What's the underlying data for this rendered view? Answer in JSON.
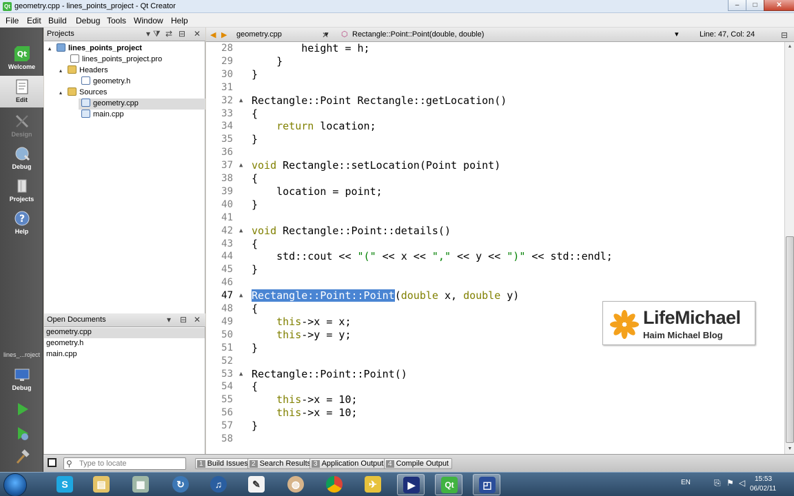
{
  "window": {
    "title": "geometry.cpp - lines_points_project - Qt Creator",
    "controls": {
      "minimize": "–",
      "maximize": "□",
      "close": "✕"
    }
  },
  "menu": [
    "File",
    "Edit",
    "Build",
    "Debug",
    "Tools",
    "Window",
    "Help"
  ],
  "modes": [
    {
      "label": "Welcome",
      "icon": "qt-logo-icon"
    },
    {
      "label": "Edit",
      "icon": "edit-document-icon"
    },
    {
      "label": "Design",
      "icon": "design-brush-icon"
    },
    {
      "label": "Debug",
      "icon": "debug-bug-icon"
    },
    {
      "label": "Projects",
      "icon": "projects-icon"
    },
    {
      "label": "Help",
      "icon": "help-icon"
    }
  ],
  "kit": {
    "project": "lines_...roject",
    "mode": "Debug"
  },
  "projects_panel": {
    "title": "Projects",
    "tree": [
      {
        "label": "lines_points_project",
        "level": 0,
        "icon": "project-icon",
        "bold": true,
        "expand": "▴"
      },
      {
        "label": "lines_points_project.pro",
        "level": 1,
        "icon": "pro-file-icon"
      },
      {
        "label": "Headers",
        "level": 1,
        "icon": "folder-icon",
        "expand": "▴"
      },
      {
        "label": "geometry.h",
        "level": 2,
        "icon": "header-file-icon"
      },
      {
        "label": "Sources",
        "level": 1,
        "icon": "folder-icon",
        "expand": "▴"
      },
      {
        "label": "geometry.cpp",
        "level": 2,
        "icon": "cpp-file-icon",
        "selected": true
      },
      {
        "label": "main.cpp",
        "level": 2,
        "icon": "cpp-file-icon"
      }
    ]
  },
  "open_documents": {
    "title": "Open Documents",
    "items": [
      {
        "label": "geometry.cpp",
        "selected": true
      },
      {
        "label": "geometry.h"
      },
      {
        "label": "main.cpp"
      }
    ]
  },
  "editor_toolbar": {
    "file": "geometry.cpp",
    "symbol": "Rectangle::Point::Point(double, double)",
    "position": "Line: 47, Col: 24"
  },
  "code": [
    {
      "n": "28",
      "t": "        height = h;"
    },
    {
      "n": "29",
      "t": "    }"
    },
    {
      "n": "30",
      "t": "}"
    },
    {
      "n": "31",
      "t": ""
    },
    {
      "n": "32",
      "t": "Rectangle::Point Rectangle::getLocation()",
      "fold": true
    },
    {
      "n": "33",
      "t": "{"
    },
    {
      "n": "34",
      "t": "    return location;",
      "kw": "return"
    },
    {
      "n": "35",
      "t": "}"
    },
    {
      "n": "36",
      "t": ""
    },
    {
      "n": "37",
      "t": "void Rectangle::setLocation(Point point)",
      "fold": true,
      "kw": "void"
    },
    {
      "n": "38",
      "t": "{"
    },
    {
      "n": "39",
      "t": "    location = point;"
    },
    {
      "n": "40",
      "t": "}"
    },
    {
      "n": "41",
      "t": ""
    },
    {
      "n": "42",
      "t": "void Rectangle::Point::details()",
      "fold": true,
      "kw": "void"
    },
    {
      "n": "43",
      "t": "{"
    },
    {
      "n": "44",
      "t": "    std::cout << \"(\" << x << \",\" << y << \")\" << std::endl;"
    },
    {
      "n": "45",
      "t": "}"
    },
    {
      "n": "46",
      "t": ""
    },
    {
      "n": "47",
      "t": "Rectangle::Point::Point(double x, double y)",
      "fold": true,
      "current": true
    },
    {
      "n": "48",
      "t": "{"
    },
    {
      "n": "49",
      "t": "    this->x = x;",
      "kw": "this"
    },
    {
      "n": "50",
      "t": "    this->y = y;",
      "kw": "this"
    },
    {
      "n": "51",
      "t": "}"
    },
    {
      "n": "52",
      "t": ""
    },
    {
      "n": "53",
      "t": "Rectangle::Point::Point()",
      "fold": true
    },
    {
      "n": "54",
      "t": "{"
    },
    {
      "n": "55",
      "t": "    this->x = 10;",
      "kw": "this"
    },
    {
      "n": "56",
      "t": "    this->x = 10;",
      "kw": "this"
    },
    {
      "n": "57",
      "t": "}"
    },
    {
      "n": "58",
      "t": ""
    }
  ],
  "watermark": {
    "brand": "LifeMichael",
    "tagline": "Haim Michael Blog"
  },
  "statusbar": {
    "locator_placeholder": "Type to locate",
    "tabs": [
      {
        "num": "1",
        "label": "Build Issues"
      },
      {
        "num": "2",
        "label": "Search Results"
      },
      {
        "num": "3",
        "label": "Application Output"
      },
      {
        "num": "4",
        "label": "Compile Output"
      }
    ]
  },
  "taskbar": {
    "apps": [
      "ie-icon",
      "skype-icon",
      "explorer-icon",
      "calculator-icon",
      "sync-icon",
      "itunes-icon",
      "notepad-icon",
      "paint-icon",
      "chrome-icon",
      "game-icon",
      "media-player-icon",
      "qt-creator-icon",
      "app-icon"
    ],
    "lang": "EN",
    "time": "15:53",
    "date": "06/02/11"
  },
  "colors": {
    "keyword": "#808000",
    "string": "#008000",
    "selection": "#4a85d3",
    "modebar": "#4b4b4b"
  }
}
